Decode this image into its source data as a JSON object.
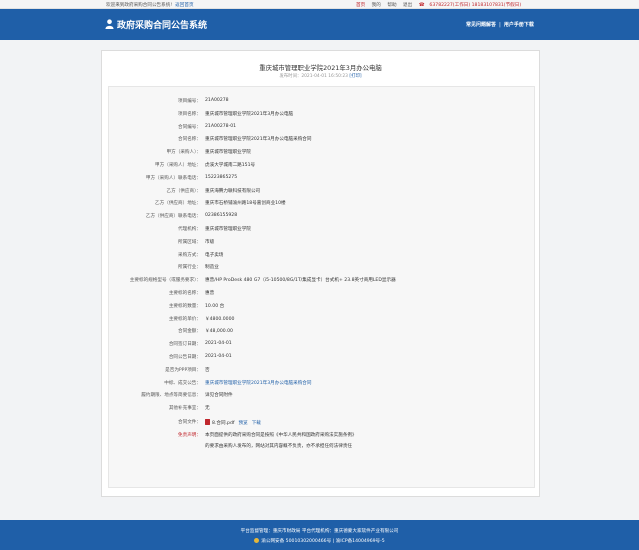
{
  "topbar": {
    "welcome": "欢迎来到政府采购合同公告系统!",
    "welcome_link": "返回首页",
    "links": [
      "首页",
      "我的",
      "帮助",
      "退出"
    ],
    "hotline": "63782227(工作日)  18183107831(节假日)"
  },
  "header": {
    "title": "政府采购合同公告系统",
    "nav": [
      "常见问题解答",
      "用户手册下载"
    ]
  },
  "doc": {
    "title": "重庆城市管理职业学院2021年3月办公电脑",
    "meta_prefix": "发布时间：2021-04-01 16:50:23",
    "print": "[打印]"
  },
  "fields": [
    {
      "label": "项目编号：",
      "value": "21A00278"
    },
    {
      "label": "项目名称：",
      "value": "重庆城市管理职业学院2021年3月办公电脑"
    },
    {
      "label": "合同编号：",
      "value": "21A00278-01"
    },
    {
      "label": "合同名称：",
      "value": "重庆城市管理职业学院2021年3月办公电脑采购合同"
    },
    {
      "label": "甲方（采购人）：",
      "value": "重庆城市管理职业学院"
    },
    {
      "label": "甲方（采购人）地址：",
      "value": "虎溪大学城南二路151号"
    },
    {
      "label": "甲方（采购人）联系电话：",
      "value": "15223865275"
    },
    {
      "label": "乙方（供应商）：",
      "value": "重庆海腾力联科技有限公司"
    },
    {
      "label": "乙方（供应商）地址：",
      "value": "重庆市石桥铺渝州路18号嘉创商业10楼"
    },
    {
      "label": "乙方（供应商）联系电话：",
      "value": "02386155928"
    },
    {
      "label": "代理机构：",
      "value": "重庆城市管理职业学院"
    },
    {
      "label": "所属区域：",
      "value": "市级"
    },
    {
      "label": "采购方式：",
      "value": "电子卖场"
    },
    {
      "label": "所属行业：",
      "value": "制造业"
    },
    {
      "label": "主要标的规格型号（或服务要求）：",
      "value": "惠普/HP ProDesk 480 G7（i5-10500/8G/1T/集成显卡）台式机+ 23.8英寸商用LED显示器"
    },
    {
      "label": "主要标的名称：",
      "value": "惠普"
    },
    {
      "label": "主要标的数量：",
      "value": "10.00 台"
    },
    {
      "label": "主要标的单价：",
      "value": "￥4800.0000"
    },
    {
      "label": "合同金额：",
      "value": "￥48,000.00"
    },
    {
      "label": "合同签订日期：",
      "value": "2021-04-01"
    },
    {
      "label": "合同公告日期：",
      "value": "2021-04-01"
    },
    {
      "label": "是否为PPP项目：",
      "value": "否"
    },
    {
      "label": "中标、成交公告：",
      "value": "重庆城市管理职业学院2021年3月办公电脑采购合同",
      "link": true
    },
    {
      "label": "履约期限、地点等简要信息：",
      "value": "详见合同附件"
    },
    {
      "label": "其他补充事宜：",
      "value": "无"
    }
  ],
  "attachment": {
    "label": "合同文件：",
    "filename": "8.合同.pdf",
    "preview": "预览",
    "download": "下载"
  },
  "disclaimer": {
    "label": "免责声明：",
    "line1": "本页面提供的政府采购合同是按照《中华人民共和国政府采购法实施条例》",
    "line2": "的要求由采购人发布的，网站对其内容概不负责，亦不承担任何法律责任"
  },
  "footer": {
    "line1": "平台监督管理：重庆市财政局    平台代理机构：重庆德蒙大家软件产业有限公司",
    "line2": "渝公网安备 50010302000466号  |  渝ICP备14004969号-5"
  },
  "colors": {
    "brand": "#1f5fa8",
    "alert": "#c0272d"
  }
}
